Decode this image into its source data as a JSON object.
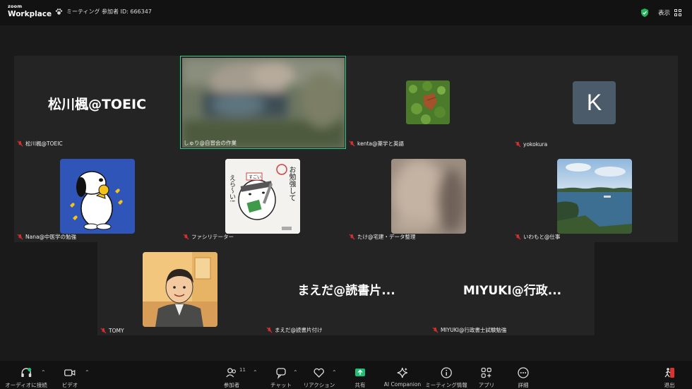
{
  "app": {
    "logo_line1": "zoom",
    "logo_line2": "Workplace"
  },
  "meeting": {
    "info": "ミーティング 参加者 ID: 666347"
  },
  "view": {
    "label": "表示"
  },
  "participants": [
    {
      "name": "松川楓@TOEIC",
      "display": "松川楓@TOEIC"
    },
    {
      "name": "しゅり@自習会の作業"
    },
    {
      "name": "kenta@薬学と英語"
    },
    {
      "name": "yokokura",
      "initial": "K"
    },
    {
      "name": "Nana@中医学の勉強"
    },
    {
      "name": "ファシリテーター"
    },
    {
      "name": "たけ@宅建・データ整理"
    },
    {
      "name": "いわもと@仕事"
    },
    {
      "name": "TOMY"
    },
    {
      "name": "まえだ@読書片付け",
      "display": "まえだ@読書片..."
    },
    {
      "name": "MIYUKI@行政書士試験勉強",
      "display": "MIYUKI@行政..."
    }
  ],
  "illustration_text": {
    "line1": "お勉強して",
    "line2": "えら〜い!",
    "badge": "すごい"
  },
  "toolbar": {
    "audio": "オーディオに接続",
    "video": "ビデオ",
    "participants": "参加者",
    "participants_count": "11",
    "chat": "チャット",
    "reactions": "リアクション",
    "share": "共有",
    "ai": "AI Companion",
    "info": "ミーティング情報",
    "apps": "アプリ",
    "more": "詳細",
    "leave": "退出"
  },
  "colors": {
    "speaking_border": "#2fd18d",
    "share_green": "#1fbf75",
    "leave_red": "#e0312f",
    "avatar_k": "#4c5b6a"
  }
}
